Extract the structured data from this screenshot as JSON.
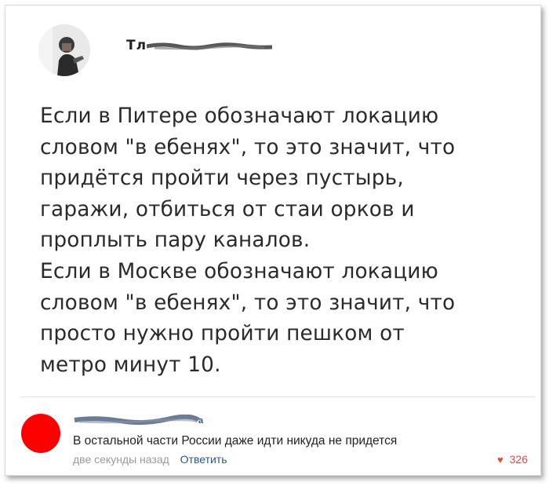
{
  "post": {
    "author": "Тл",
    "lines": [
      "Если в Питере обозначают локацию",
      "словом \"в ебенях\", то это значит, что",
      "придётся пройти через пустырь,",
      "гаражи, отбиться от стаи орков и",
      "проплыть пару каналов.",
      "Если в Москве обозначают локацию",
      "словом \"в ебенях\", то это значит, что",
      "просто нужно пройти пешком от",
      "метро минут 10."
    ]
  },
  "comment": {
    "author_fragment": "а",
    "text": "В остальной части России даже идти никуда не придется",
    "time": "две секунды назад",
    "reply_label": "Ответить",
    "likes": "326",
    "avatar_color": "#ff0000",
    "like_color": "#e64646"
  }
}
